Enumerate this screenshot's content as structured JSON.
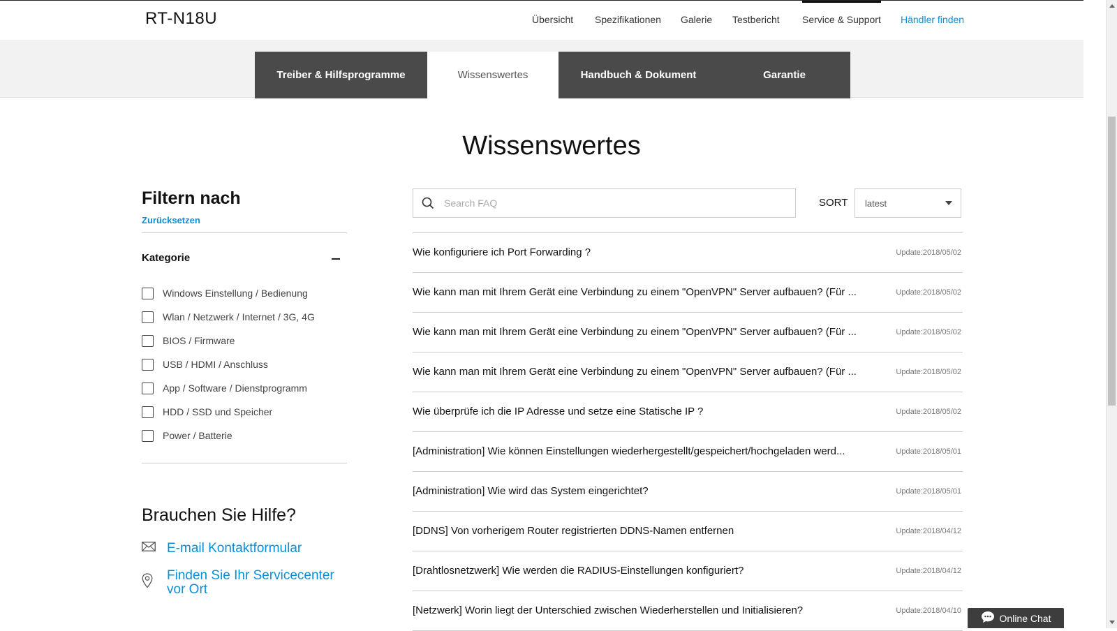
{
  "brand": "RT-N18U",
  "top_nav": [
    {
      "label": "Übersicht"
    },
    {
      "label": "Spezifikationen"
    },
    {
      "label": "Galerie"
    },
    {
      "label": "Testbericht"
    },
    {
      "label": "Service & Support"
    },
    {
      "label": "Händler finden"
    }
  ],
  "tabs": [
    {
      "label": "Treiber & Hilfsprogramme"
    },
    {
      "label": "Wissenswertes"
    },
    {
      "label": "Handbuch & Dokument"
    },
    {
      "label": "Garantie"
    }
  ],
  "page_title": "Wissenswertes",
  "sidebar": {
    "filter_title": "Filtern nach",
    "reset_label": "Zurücksetzen",
    "category_label": "Kategorie",
    "categories": [
      "Windows Einstellung / Bedienung",
      "Wlan / Netzwerk / Internet / 3G, 4G",
      "BIOS / Firmware",
      "USB / HDMI / Anschluss",
      "App / Software / Dienstprogramm",
      "HDD / SSD und Speicher",
      "Power / Batterie"
    ],
    "help_title": "Brauchen Sie Hilfe?",
    "email_link": "E-mail Kontaktformular",
    "service_link": "Finden Sie Ihr Servicecenter vor Ort"
  },
  "search": {
    "placeholder": "Search FAQ"
  },
  "sort": {
    "label": "SORT",
    "value": "latest"
  },
  "faqs": [
    {
      "question": "Wie konfiguriere ich Port Forwarding ?",
      "date": "Update:2018/05/02"
    },
    {
      "question": "Wie kann man mit Ihrem Gerät eine Verbindung zu einem \"OpenVPN\" Server aufbauen? (Für ...",
      "date": "Update:2018/05/02"
    },
    {
      "question": "Wie kann man mit Ihrem Gerät eine Verbindung zu einem \"OpenVPN\" Server aufbauen? (Für ...",
      "date": "Update:2018/05/02"
    },
    {
      "question": "Wie kann man mit Ihrem Gerät eine Verbindung zu einem \"OpenVPN\" Server aufbauen? (Für ...",
      "date": "Update:2018/05/02"
    },
    {
      "question": "Wie überprüfe ich die IP Adresse und setze eine Statische IP ?",
      "date": "Update:2018/05/02"
    },
    {
      "question": "[Administration] Wie können Einstellungen wiederhergestellt/gespeichert/hochgeladen werd...",
      "date": "Update:2018/05/01"
    },
    {
      "question": "[Administration] Wie wird das System eingerichtet?",
      "date": "Update:2018/05/01"
    },
    {
      "question": "[DDNS] Von vorherigem Router registrierten DDNS-Namen entfernen",
      "date": "Update:2018/04/12"
    },
    {
      "question": "[Drahtlosnetzwerk] Wie werden die RADIUS-Einstellungen konfiguriert?",
      "date": "Update:2018/04/12"
    },
    {
      "question": "[Netzwerk] Worin liegt der Unterschied zwischen Wiederherstellen und Initialisieren?",
      "date": "Update:2018/04/10"
    }
  ],
  "chat": {
    "label": "Online Chat"
  },
  "colors": {
    "accent": "#0a8fd8",
    "tab_dark": "#4a4a4a",
    "chat_bg": "#3d3d3d"
  }
}
